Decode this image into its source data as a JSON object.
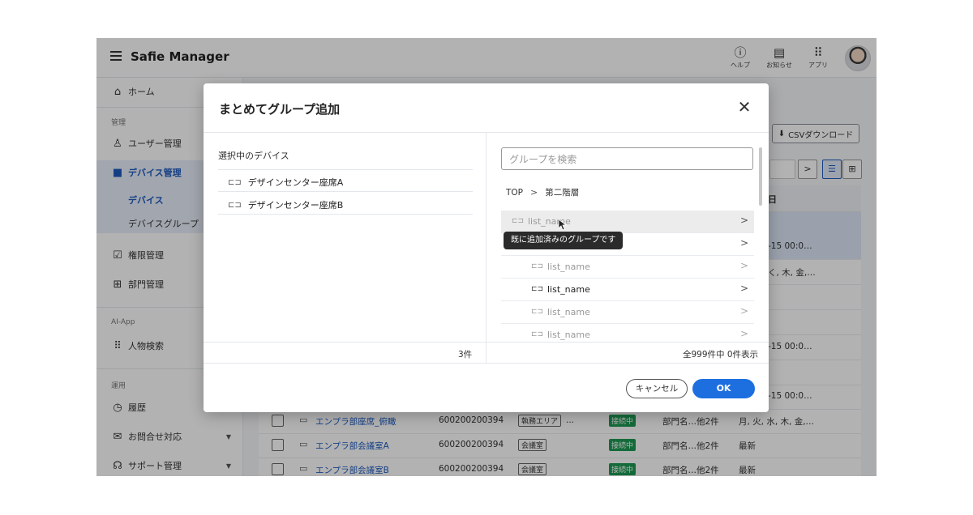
{
  "header": {
    "app_title": "Safie Manager",
    "help_label": "ヘルプ",
    "notice_label": "お知らせ",
    "apps_label": "アプリ"
  },
  "sidebar": {
    "home": "ホーム",
    "section_admin": "管理",
    "user_mgmt": "ユーザー管理",
    "device_mgmt": "デバイス管理",
    "devices": "デバイス",
    "device_groups": "デバイスグループ",
    "permission_mgmt": "権限管理",
    "dept_mgmt": "部門管理",
    "section_aiapp": "AI-App",
    "people_search": "人物検索",
    "section_ops": "運用",
    "history": "履歴",
    "contact": "お問合せ対応",
    "support": "サポート管理"
  },
  "main": {
    "csv_download": "CSVダウンロード",
    "next_page": ">",
    "column_date_suffix": "日",
    "partial_rows": [
      {
        "date": "-15 00:0…"
      },
      {
        "date": "く, 木, 金,…"
      },
      {
        "date": "-15 00:0…"
      },
      {
        "date": "-15 00:0…"
      }
    ],
    "rows": [
      {
        "name": "エンプラ部座席_俯瞰",
        "serial": "600200200394",
        "area": "執務エリア",
        "area_more": "...",
        "status": "接続中",
        "dept": "部門名…他2件",
        "schedule": "月, 火, 水, 木, 金,…"
      },
      {
        "name": "エンプラ部会議室A",
        "serial": "600200200394",
        "area": "会議室",
        "area_more": "",
        "status": "接続中",
        "dept": "部門名…他2件",
        "schedule": "最新"
      },
      {
        "name": "エンプラ部会議室B",
        "serial": "600200200394",
        "area": "会議室",
        "area_more": "",
        "status": "接続中",
        "dept": "部門名…他2件",
        "schedule": "最新"
      }
    ]
  },
  "modal": {
    "title": "まとめてグループ追加",
    "close": "✕",
    "left_heading": "選択中のデバイス",
    "selected_devices": [
      "デザインセンター座席A",
      "デザインセンター座席B"
    ],
    "left_count": "3件",
    "search_placeholder": "グループを検索",
    "breadcrumb": [
      "TOP",
      "第二階層"
    ],
    "groups": [
      {
        "name": "list_name",
        "enabled": false
      },
      {
        "name": "",
        "enabled": true
      },
      {
        "name": "list_name",
        "enabled": false
      },
      {
        "name": "list_name",
        "enabled": true
      },
      {
        "name": "list_name",
        "enabled": false
      },
      {
        "name": "list_name",
        "enabled": false
      }
    ],
    "tooltip": "既に追加済みのグループです",
    "right_count": "全999件中 0件表示",
    "cancel": "キャンセル",
    "ok": "OK"
  },
  "colors": {
    "accent": "#1d6fe0",
    "status_green": "#1e9a53",
    "link_blue": "#1d5bbf"
  }
}
